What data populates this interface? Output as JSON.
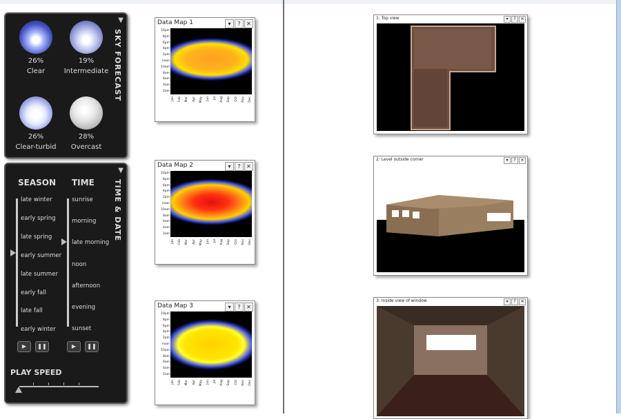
{
  "sky_forecast": {
    "title": "SKY FORECAST",
    "skies": [
      {
        "pct": "26%",
        "label": "Clear"
      },
      {
        "pct": "19%",
        "label": "Intermediate"
      },
      {
        "pct": "26%",
        "label": "Clear-turbid"
      },
      {
        "pct": "28%",
        "label": "Overcast"
      }
    ]
  },
  "time_date": {
    "title": "TIME & DATE",
    "season_title": "SEASON",
    "time_title": "TIME",
    "seasons": [
      "late winter",
      "early spring",
      "late spring",
      "early summer",
      "late summer",
      "early fall",
      "late fall",
      "early winter"
    ],
    "selected_season": "early summer",
    "times": [
      "sunrise",
      "morning",
      "late morning",
      "noon",
      "afternoon",
      "evening",
      "sunset"
    ],
    "selected_time": "late morning",
    "play_label": "▶",
    "pause_label": "❚❚",
    "play_speed_title": "PLAY SPEED"
  },
  "data_maps": [
    {
      "title": "Data Map 1"
    },
    {
      "title": "Data Map 2"
    },
    {
      "title": "Data Map 3"
    }
  ],
  "map_hours": [
    "10pm",
    "8pm",
    "6pm",
    "4pm",
    "2pm",
    "noon",
    "10am",
    "8am",
    "6am",
    "4am",
    "2am"
  ],
  "map_months": [
    "Jan",
    "Feb",
    "Mar",
    "Apr",
    "May",
    "Jun",
    "Jul",
    "Aug",
    "Sep",
    "Oct",
    "Nov",
    "Dec"
  ],
  "window_buttons": {
    "menu": "▾",
    "help": "?",
    "close": "✕"
  },
  "views": [
    {
      "title": "1: Top view"
    },
    {
      "title": "2: Level outside corner"
    },
    {
      "title": "3: Inside view of window"
    }
  ]
}
